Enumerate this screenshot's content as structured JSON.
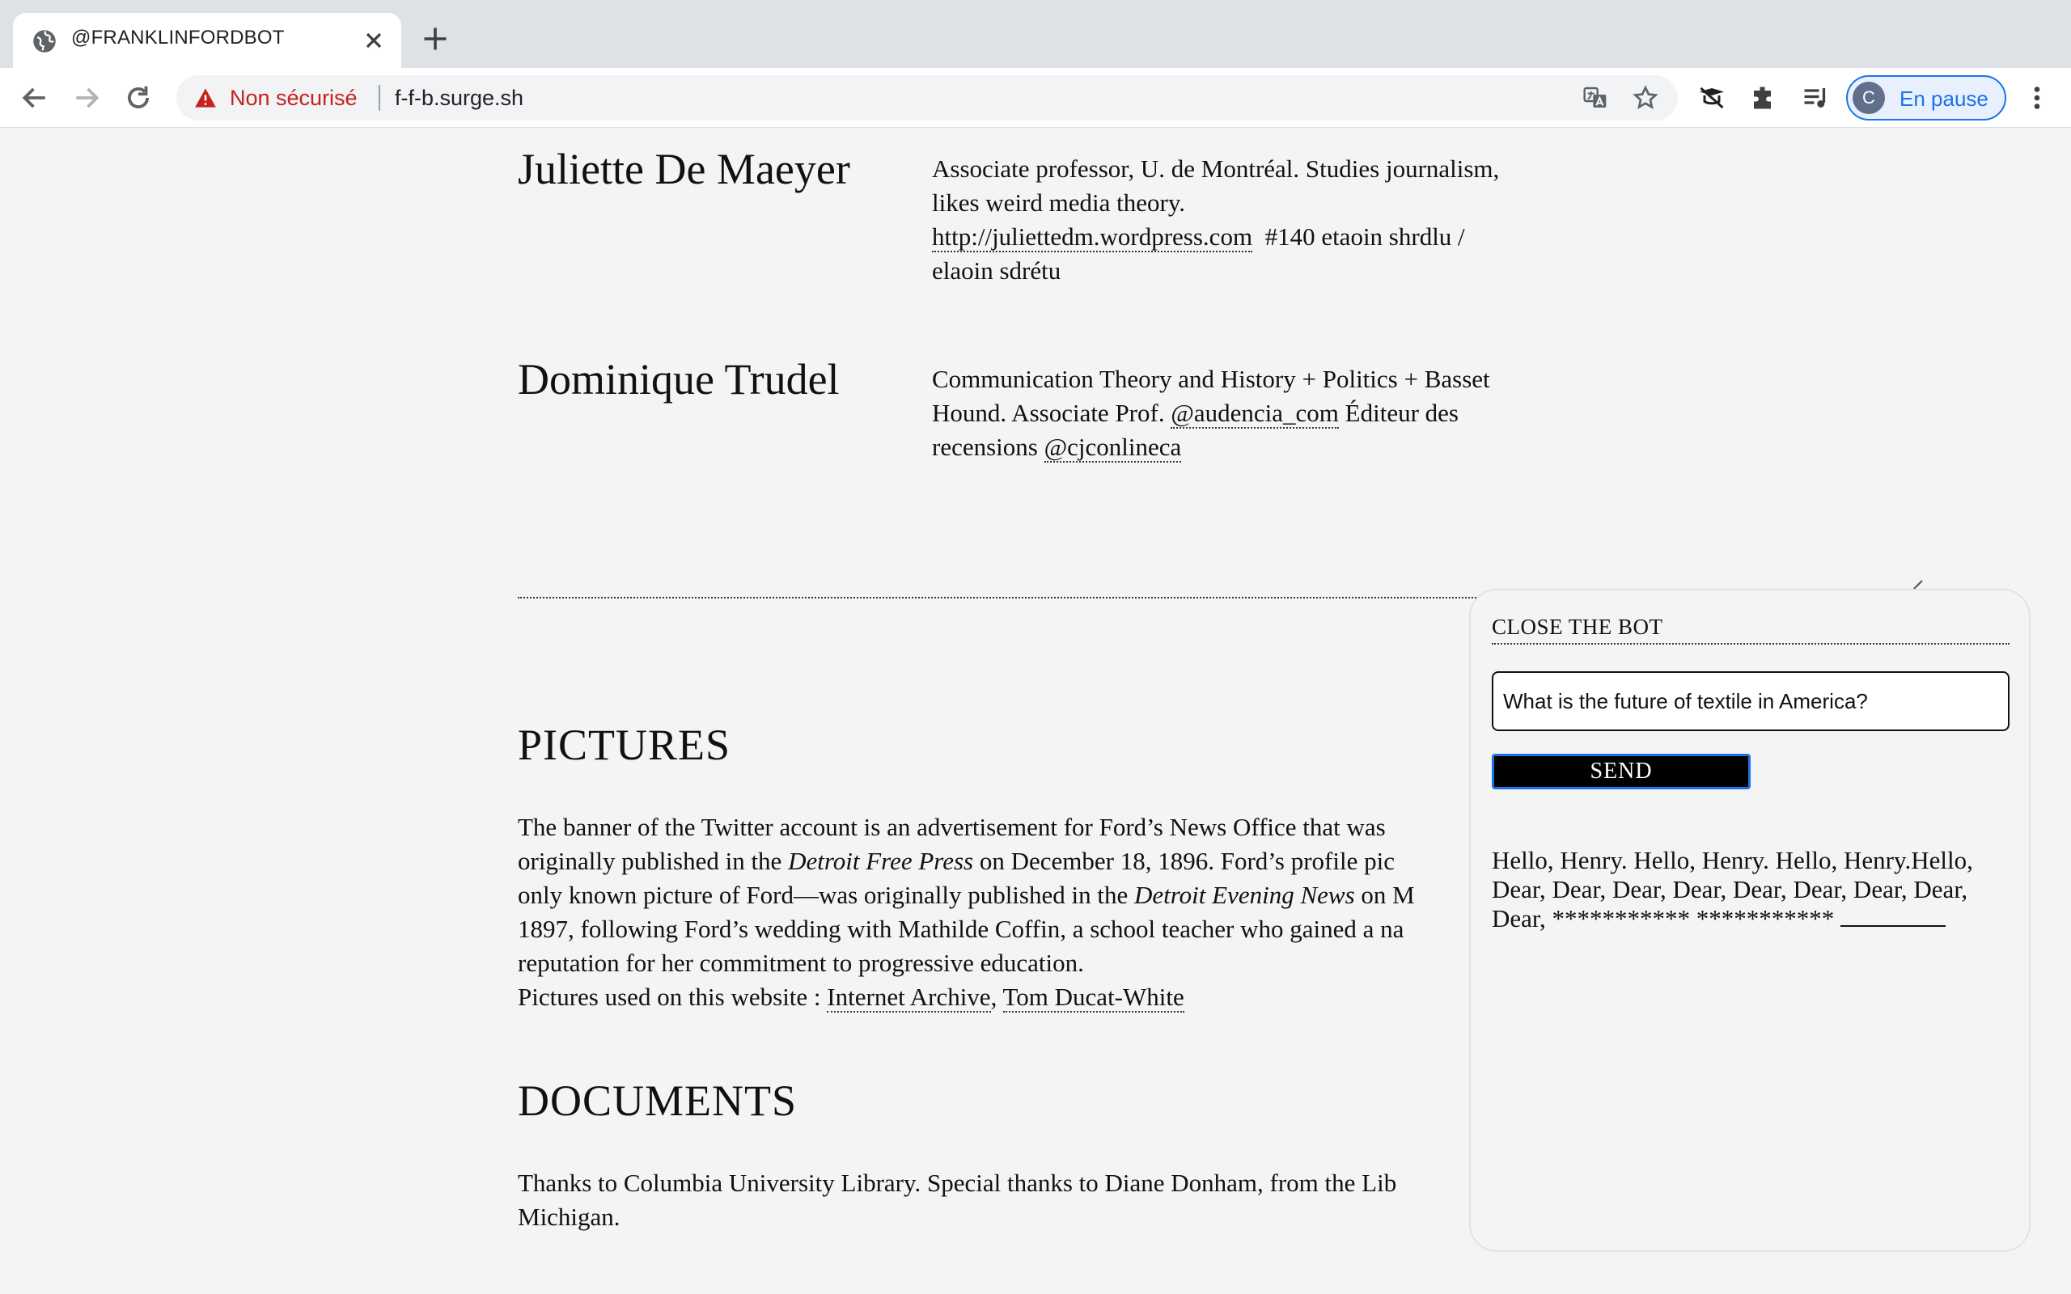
{
  "browser": {
    "tab_title": "@FRANKLINFORDBOT",
    "security_label": "Non sécurisé",
    "url": "f-f-b.surge.sh",
    "profile_initial": "C",
    "profile_status": "En pause",
    "accent_color": "#1a73e8",
    "warning_color": "#c5221f"
  },
  "people": [
    {
      "name": "Juliette De Maeyer",
      "bio_line1": "Associate professor, U. de Montréal. Studies journalism,",
      "bio_line2": "likes weird media theory.",
      "link": "http://juliettedm.wordpress.com",
      "bio_tail": "#140 etaoin shrdlu /",
      "bio_line4": "elaoin sdrétu"
    },
    {
      "name": "Dominique Trudel",
      "bio_line1": "Communication Theory and History + Politics + Basset",
      "bio_line2_pre": "Hound. Associate Prof.",
      "handle1": "@audencia_com",
      "bio_line2_post": "Éditeur des",
      "bio_line3_pre": "recensions",
      "handle2": "@cjconlineca"
    }
  ],
  "pictures": {
    "title": "PICTURES",
    "line1": "The banner of the Twitter account is an advertisement for Ford’s News Office that was",
    "line2_pre": "originally published in the",
    "line2_italic": "Detroit Free Press",
    "line2_post": "on December 18, 1896. Ford’s profile pic",
    "line3_pre": "only known picture of Ford—was originally published in the",
    "line3_italic": "Detroit Evening News",
    "line3_post": "on M",
    "line4": "1897, following Ford’s wedding with Mathilde Coffin, a school teacher who gained a na",
    "line5": "reputation for her commitment to progressive education.",
    "credits_label": "Pictures used on this website :",
    "credit_link1": "Internet Archive",
    "credit_link2": "Tom Ducat-White"
  },
  "documents": {
    "title": "DOCUMENTS",
    "line1": "Thanks to Columbia University Library. Special thanks to Diane Donham, from the Lib",
    "line2": "Michigan."
  },
  "bot": {
    "close_label": "CLOSE THE BOT",
    "input_value": "What is the future of textile in America?",
    "send_label": "SEND",
    "reply_line1": "Hello, Henry. Hello, Henry. Hello, Henry.Hello,",
    "reply_line2": "Dear, Dear, Dear, Dear, Dear, Dear, Dear, Dear,",
    "reply_line3": "Dear, *********** ***********"
  }
}
